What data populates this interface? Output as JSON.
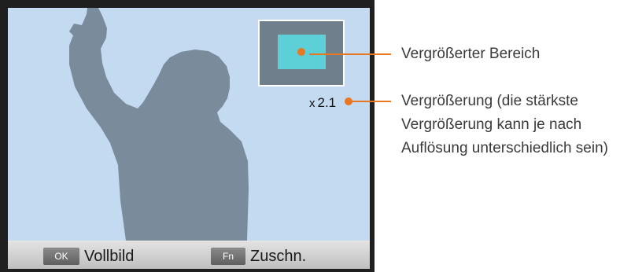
{
  "preview": {
    "zoom_prefix": "x",
    "zoom_value": "2.1"
  },
  "bottom_bar": {
    "ok_key": "OK",
    "ok_label": "Vollbild",
    "fn_key": "Fn",
    "fn_label": "Zuschn."
  },
  "callouts": {
    "area": "Vergrößerter Bereich",
    "magnification_line1": "Vergrößerung (die stärkste",
    "magnification_line2": "Vergrößerung kann je nach",
    "magnification_line3": "Auflösung unterschiedlich sein)"
  },
  "colors": {
    "callout_accent": "#e87722",
    "viewport_bg": "#c3daf0",
    "silhouette": "#7a8b9b",
    "navigator_bg": "#6f7f8c",
    "navigator_area": "#5ccfd7"
  }
}
